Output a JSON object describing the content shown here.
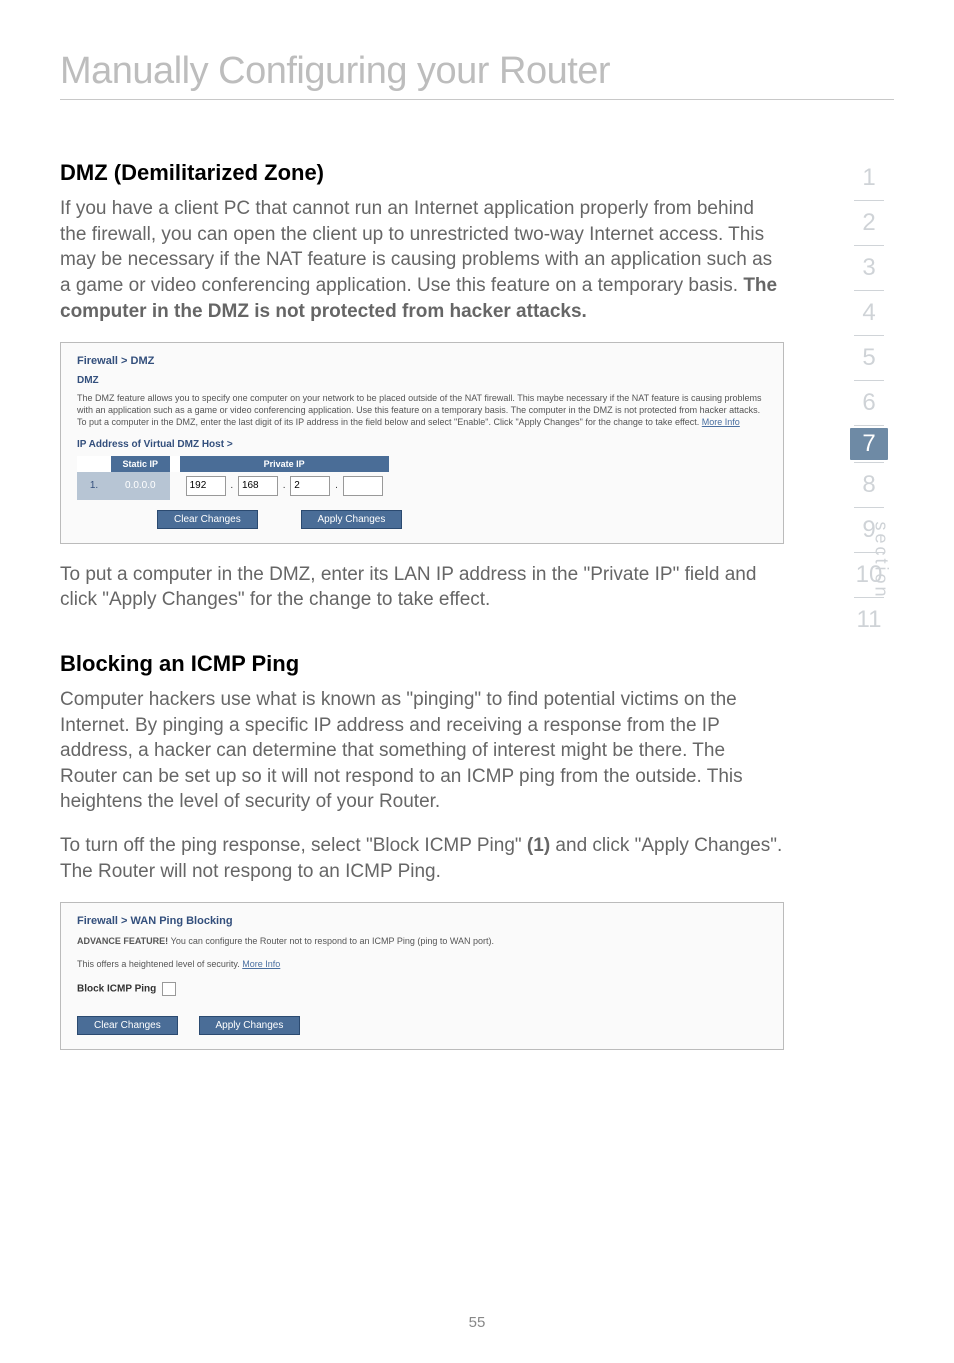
{
  "page": {
    "title": "Manually Configuring your Router",
    "number": "55"
  },
  "sidenav": {
    "items": [
      "1",
      "2",
      "3",
      "4",
      "5",
      "6",
      "7",
      "8",
      "9",
      "10",
      "11"
    ],
    "current": "7",
    "label": "section"
  },
  "dmz": {
    "heading": "DMZ (Demilitarized Zone)",
    "intro_text": "If you have a client PC that cannot run an Internet application properly from behind the firewall, you can open the client up to unrestricted two-way Internet access. This may be necessary if the NAT feature is causing problems with an application such as a game or video conferencing application. Use this feature on a temporary basis. ",
    "intro_strong": "The computer in the DMZ is not protected from hacker attacks.",
    "panel": {
      "breadcrumb": "Firewall > DMZ",
      "subtitle": "DMZ",
      "desc": "The DMZ feature allows you to specify one computer on your network to be placed outside of the NAT firewall. This maybe necessary if the NAT feature is causing problems with an application such as a game or video conferencing application. Use this feature on a temporary basis. The computer in the DMZ is not protected from hacker attacks. To put a computer in the DMZ, enter the last digit of its IP address in the field below and select \"Enable\". Click \"Apply Changes\" for the change to take effect. ",
      "more_info": "More Info",
      "section_label": "IP Address of Virtual DMZ Host >",
      "th_static": "Static IP",
      "th_private": "Private IP",
      "row_index": "1.",
      "static_ip": "0.0.0.0",
      "oct1": "192",
      "oct2": "168",
      "oct3": "2",
      "oct4": "",
      "clear_btn": "Clear Changes",
      "apply_btn": "Apply Changes"
    },
    "followup": "To put a computer in the DMZ, enter its LAN IP address in the \"Private IP\" field and click \"Apply Changes\" for the change to take effect."
  },
  "icmp": {
    "heading": "Blocking an ICMP Ping",
    "para1": "Computer hackers use what is known as \"pinging\" to find potential victims on the Internet. By pinging a specific IP address and receiving a response from the IP address, a hacker can determine that something of interest might be there. The Router can be set up so it will not respond to an ICMP ping from the outside. This heightens the level of security of your Router.",
    "para2_a": "To turn off the ping response, select \"Block ICMP Ping\" ",
    "para2_ref": "(1)",
    "para2_b": " and click \"Apply Changes\". The Router will not respong to an ICMP Ping.",
    "panel": {
      "breadcrumb": "Firewall > WAN Ping Blocking",
      "line1_strong": "ADVANCE FEATURE! ",
      "line1_rest": "You can configure the Router not to respond to an ICMP Ping (ping to WAN port).",
      "line2_a": "This offers a heightened level of security. ",
      "more_info": "More Info",
      "checkbox_label": "Block ICMP Ping",
      "clear_btn": "Clear Changes",
      "apply_btn": "Apply Changes"
    }
  }
}
